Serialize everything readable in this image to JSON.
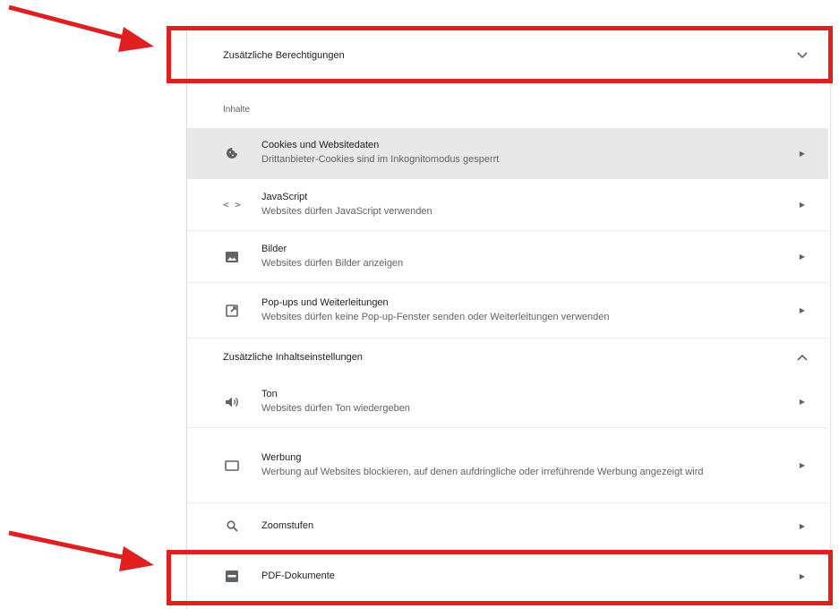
{
  "header": {
    "title": "Zusätzliche Berechtigungen"
  },
  "sections": {
    "inhalte": "Inhalte",
    "zusatz": "Zusätzliche Inhaltseinstellungen"
  },
  "items": [
    {
      "title": "Cookies und Websitedaten",
      "sub": "Drittanbieter-Cookies sind im Inkognitomodus gesperrt",
      "icon": "cookie-icon"
    },
    {
      "title": "JavaScript",
      "sub": "Websites dürfen JavaScript verwenden",
      "icon": "code-icon"
    },
    {
      "title": "Bilder",
      "sub": "Websites dürfen Bilder anzeigen",
      "icon": "image-icon"
    },
    {
      "title": "Pop-ups und Weiterleitungen",
      "sub": "Websites dürfen keine Pop-up-Fenster senden oder Weiterleitungen verwenden",
      "icon": "popup-icon"
    },
    {
      "title": "Ton",
      "sub": "Websites dürfen Ton wiedergeben",
      "icon": "speaker-icon"
    },
    {
      "title": "Werbung",
      "sub": "Werbung auf Websites blockieren, auf denen aufdringliche oder irreführende Werbung angezeigt wird",
      "icon": "ads-icon"
    },
    {
      "title": "Zoomstufen",
      "icon": "search-icon"
    },
    {
      "title": "PDF-Dokumente",
      "icon": "pdf-icon"
    }
  ],
  "colors": {
    "highlight": "#e02020",
    "hover_row": "#e8e8e8"
  }
}
